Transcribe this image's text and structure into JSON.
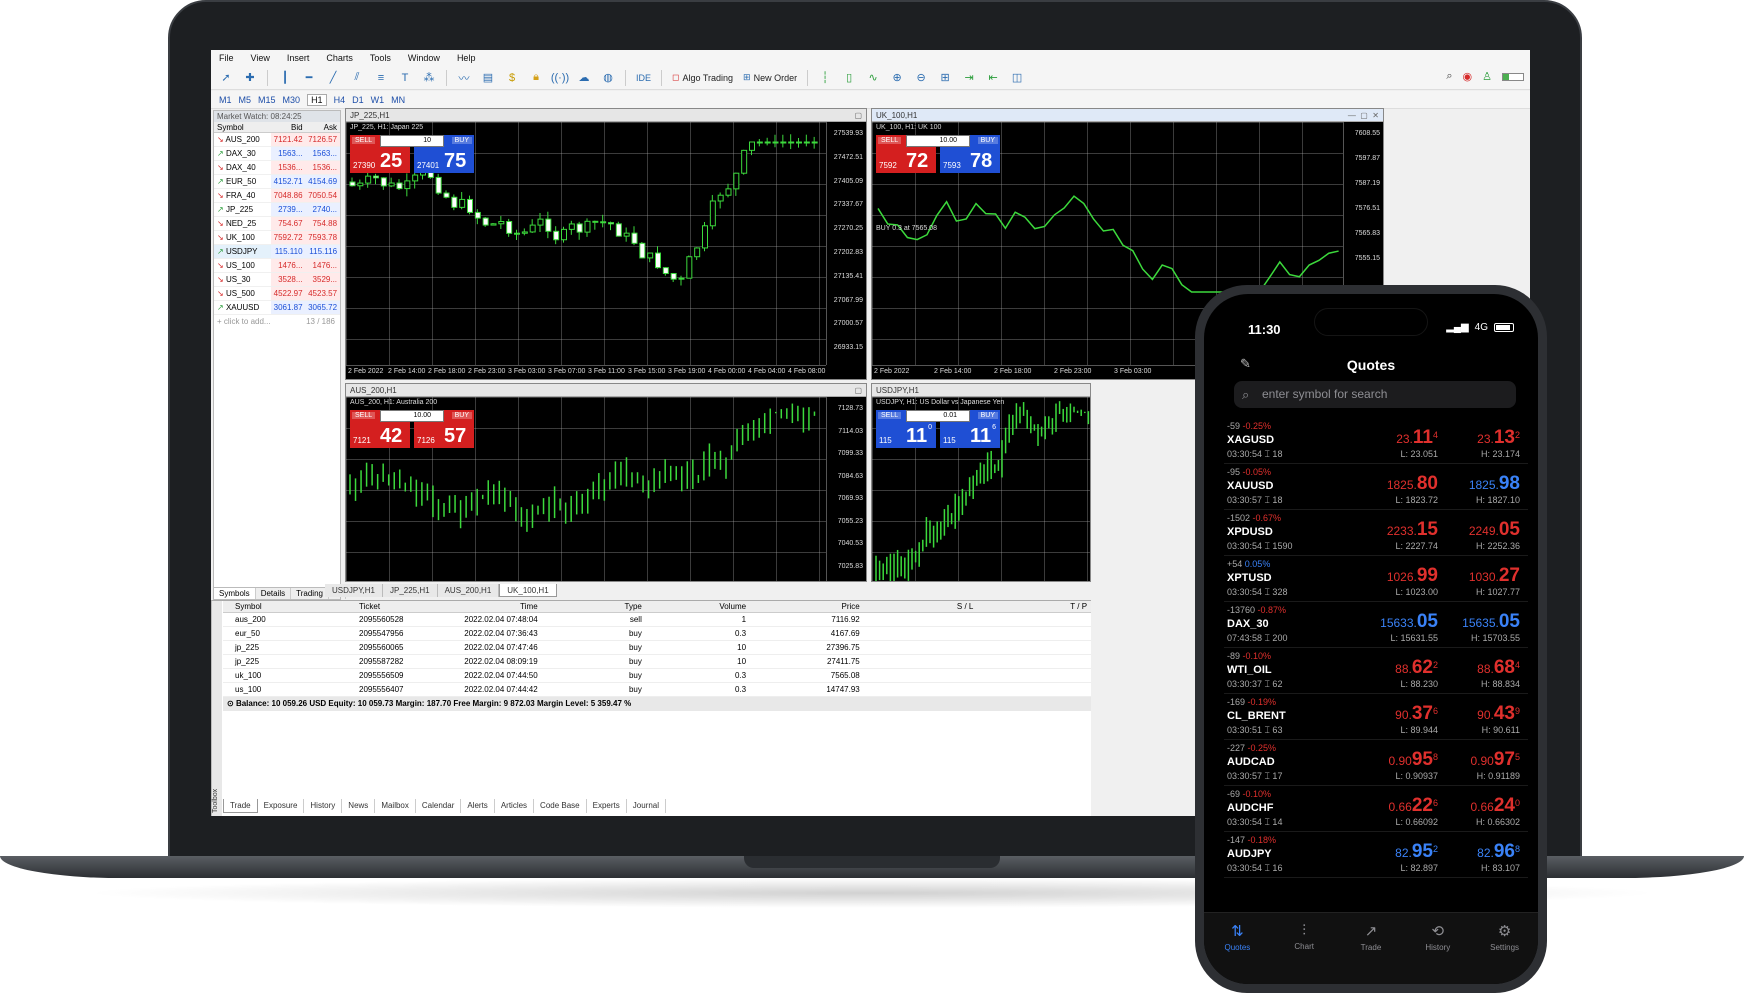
{
  "menu": [
    "File",
    "View",
    "Insert",
    "Charts",
    "Tools",
    "Window",
    "Help"
  ],
  "toolbar": {
    "ide": "IDE",
    "algo": "Algo Trading",
    "new_order": "New Order"
  },
  "timeframes": [
    "M1",
    "M5",
    "M15",
    "M30",
    "H1",
    "H4",
    "D1",
    "W1",
    "MN"
  ],
  "market_watch": {
    "title": "Market Watch: 08:24:25",
    "headers": {
      "symbol": "Symbol",
      "bid": "Bid",
      "ask": "Ask"
    },
    "rows": [
      {
        "symbol": "AUS_200",
        "bid": "7121.42",
        "ask": "7126.57",
        "dir": "dn"
      },
      {
        "symbol": "DAX_30",
        "bid": "1563...",
        "ask": "1563...",
        "dir": "up"
      },
      {
        "symbol": "DAX_40",
        "bid": "1536...",
        "ask": "1536...",
        "dir": "dn"
      },
      {
        "symbol": "EUR_50",
        "bid": "4152.71",
        "ask": "4154.69",
        "dir": "up"
      },
      {
        "symbol": "FRA_40",
        "bid": "7048.86",
        "ask": "7050.54",
        "dir": "dn"
      },
      {
        "symbol": "JP_225",
        "bid": "2739...",
        "ask": "2740...",
        "dir": "up"
      },
      {
        "symbol": "NED_25",
        "bid": "754.67",
        "ask": "754.88",
        "dir": "dn"
      },
      {
        "symbol": "UK_100",
        "bid": "7592.72",
        "ask": "7593.78",
        "dir": "dn"
      },
      {
        "symbol": "USDJPY",
        "bid": "115.110",
        "ask": "115.116",
        "dir": "up",
        "selected": true
      },
      {
        "symbol": "US_100",
        "bid": "1476...",
        "ask": "1476...",
        "dir": "dn"
      },
      {
        "symbol": "US_30",
        "bid": "3528...",
        "ask": "3529...",
        "dir": "dn"
      },
      {
        "symbol": "US_500",
        "bid": "4522.97",
        "ask": "4523.57",
        "dir": "dn"
      },
      {
        "symbol": "XAUUSD",
        "bid": "3061.87",
        "ask": "3065.72",
        "dir": "up"
      }
    ],
    "add_text": "click to add...",
    "count": "13 / 186",
    "tabs": [
      "Symbols",
      "Details",
      "Trading",
      "Ti"
    ]
  },
  "charts": [
    {
      "title": "JP_225,H1",
      "sub": "JP_225, H1: Japan 225",
      "lot": "10",
      "sell_small": "27390",
      "sell_big": "25",
      "buy_small": "27401",
      "buy_big": "75",
      "prices": [
        "27539.93",
        "27472.51",
        "27405.09",
        "27337.67",
        "27270.25",
        "27202.83",
        "27135.41",
        "27067.99",
        "27000.57",
        "26933.15"
      ],
      "times": [
        "2 Feb 2022",
        "2 Feb 14:00",
        "2 Feb 18:00",
        "2 Feb 23:00",
        "3 Feb 03:00",
        "3 Feb 07:00",
        "3 Feb 11:00",
        "3 Feb 15:00",
        "3 Feb 19:00",
        "4 Feb 00:00",
        "4 Feb 04:00",
        "4 Feb 08:00"
      ]
    },
    {
      "title": "UK_100,H1",
      "sub": "UK_100, H1: UK 100",
      "lot": "10.00",
      "sell_small": "7592",
      "sell_big": "72",
      "buy_small": "7593",
      "buy_big": "78",
      "order_label": "BUY 0.3 at 7565.08",
      "prices": [
        "7608.55",
        "7597.87",
        "7587.19",
        "7576.51",
        "7565.83",
        "7555.15"
      ],
      "times": [
        "2 Feb 2022",
        "2 Feb 14:00",
        "2 Feb 18:00",
        "2 Feb 23:00",
        "3 Feb 03:00"
      ]
    },
    {
      "title": "AUS_200,H1",
      "sub": "AUS_200, H1: Australia 200",
      "lot": "10.00",
      "sell_small": "7121",
      "sell_big": "42",
      "buy_small": "7126",
      "buy_big": "57",
      "prices": [
        "7128.73",
        "7114.03",
        "7099.33",
        "7084.63",
        "7069.93",
        "7055.23",
        "7040.53",
        "7025.83"
      ]
    },
    {
      "title": "USDJPY,H1",
      "sub": "USDJPY, H1: US Dollar vs Japanese Yen",
      "lot": "0.01",
      "sell_small": "115",
      "sell_big": "11",
      "sell_sup": "0",
      "buy_small": "115",
      "buy_big": "11",
      "buy_sup": "6"
    }
  ],
  "chart_tabs": [
    "USDJPY,H1",
    "JP_225,H1",
    "AUS_200,H1",
    "UK_100,H1"
  ],
  "trade": {
    "headers": [
      "Symbol",
      "Ticket",
      "Time",
      "Type",
      "Volume",
      "Price",
      "S / L",
      "T / P"
    ],
    "rows": [
      [
        "aus_200",
        "2095560528",
        "2022.02.04 07:48:04",
        "sell",
        "1",
        "7116.92"
      ],
      [
        "eur_50",
        "2095547956",
        "2022.02.04 07:36:43",
        "buy",
        "0.3",
        "4167.69"
      ],
      [
        "jp_225",
        "2095560065",
        "2022.02.04 07:47:46",
        "buy",
        "10",
        "27396.75"
      ],
      [
        "jp_225",
        "2095587282",
        "2022.02.04 08:09:19",
        "buy",
        "10",
        "27411.75"
      ],
      [
        "uk_100",
        "2095556509",
        "2022.02.04 07:44:50",
        "buy",
        "0.3",
        "7565.08"
      ],
      [
        "us_100",
        "2095556407",
        "2022.02.04 07:44:42",
        "buy",
        "0.3",
        "14747.93"
      ]
    ],
    "balance": "Balance: 10 059.26 USD  Equity: 10 059.73  Margin: 187.70  Free Margin: 9 872.03  Margin Level: 5 359.47 %",
    "tabs": [
      "Trade",
      "Exposure",
      "History",
      "News",
      "Mailbox",
      "Calendar",
      "Alerts",
      "Articles",
      "Code Base",
      "Experts",
      "Journal"
    ],
    "toolbox": "Toolbox"
  },
  "phone": {
    "time": "11:30",
    "network": "4G",
    "title": "Quotes",
    "search_placeholder": "enter symbol for search",
    "quotes": [
      {
        "pts": "-59",
        "pct": "-0.25%",
        "sym": "XAGUSD",
        "meta": "03:30:54 ⌶ 18",
        "bid_pre": "23.",
        "bid_big": "11",
        "bid_sup": "4",
        "ask_pre": "23.",
        "ask_big": "13",
        "ask_sup": "2",
        "low": "L: 23.051",
        "high": "H: 23.174",
        "bid_color": "red",
        "ask_color": "red",
        "neg": true
      },
      {
        "pts": "-95",
        "pct": "-0.05%",
        "sym": "XAUUSD",
        "meta": "03:30:57 ⌶ 18",
        "bid_pre": "1825.",
        "bid_big": "80",
        "bid_sup": "",
        "ask_pre": "1825.",
        "ask_big": "98",
        "ask_sup": "",
        "low": "L: 1823.72",
        "high": "H: 1827.10",
        "bid_color": "red",
        "ask_color": "blue",
        "neg": true
      },
      {
        "pts": "-1502",
        "pct": "-0.67%",
        "sym": "XPDUSD",
        "meta": "03:30:54 ⌶ 1590",
        "bid_pre": "2233.",
        "bid_big": "15",
        "bid_sup": "",
        "ask_pre": "2249.",
        "ask_big": "05",
        "ask_sup": "",
        "low": "L: 2227.74",
        "high": "H: 2252.36",
        "bid_color": "red",
        "ask_color": "red",
        "neg": true
      },
      {
        "pts": "+54",
        "pct": "0.05%",
        "sym": "XPTUSD",
        "meta": "03:30:54 ⌶ 328",
        "bid_pre": "1026.",
        "bid_big": "99",
        "bid_sup": "",
        "ask_pre": "1030.",
        "ask_big": "27",
        "ask_sup": "",
        "low": "L: 1023.00",
        "high": "H: 1027.77",
        "bid_color": "red",
        "ask_color": "red",
        "neg": false
      },
      {
        "pts": "-13760",
        "pct": "-0.87%",
        "sym": "DAX_30",
        "meta": "07:43:58 ⌶ 200",
        "bid_pre": "15633.",
        "bid_big": "05",
        "bid_sup": "",
        "ask_pre": "15635.",
        "ask_big": "05",
        "ask_sup": "",
        "low": "L: 15631.55",
        "high": "H: 15703.55",
        "bid_color": "blue",
        "ask_color": "blue",
        "neg": true
      },
      {
        "pts": "-89",
        "pct": "-0.10%",
        "sym": "WTI_OIL",
        "meta": "03:30:37 ⌶ 62",
        "bid_pre": "88.",
        "bid_big": "62",
        "bid_sup": "2",
        "ask_pre": "88.",
        "ask_big": "68",
        "ask_sup": "4",
        "low": "L: 88.230",
        "high": "H: 88.834",
        "bid_color": "red",
        "ask_color": "red",
        "neg": true
      },
      {
        "pts": "-169",
        "pct": "-0.19%",
        "sym": "CL_BRENT",
        "meta": "03:30:51 ⌶ 63",
        "bid_pre": "90.",
        "bid_big": "37",
        "bid_sup": "6",
        "ask_pre": "90.",
        "ask_big": "43",
        "ask_sup": "9",
        "low": "L: 89.944",
        "high": "H: 90.611",
        "bid_color": "red",
        "ask_color": "red",
        "neg": true
      },
      {
        "pts": "-227",
        "pct": "-0.25%",
        "sym": "AUDCAD",
        "meta": "03:30:57 ⌶ 17",
        "bid_pre": "0.90",
        "bid_big": "95",
        "bid_sup": "8",
        "ask_pre": "0.90",
        "ask_big": "97",
        "ask_sup": "5",
        "low": "L: 0.90937",
        "high": "H: 0.91189",
        "bid_color": "red",
        "ask_color": "red",
        "neg": true
      },
      {
        "pts": "-69",
        "pct": "-0.10%",
        "sym": "AUDCHF",
        "meta": "03:30:54 ⌶ 14",
        "bid_pre": "0.66",
        "bid_big": "22",
        "bid_sup": "6",
        "ask_pre": "0.66",
        "ask_big": "24",
        "ask_sup": "0",
        "low": "L: 0.66092",
        "high": "H: 0.66302",
        "bid_color": "red",
        "ask_color": "red",
        "neg": true
      },
      {
        "pts": "-147",
        "pct": "-0.18%",
        "sym": "AUDJPY",
        "meta": "03:30:54 ⌶ 16",
        "bid_pre": "82.",
        "bid_big": "95",
        "bid_sup": "2",
        "ask_pre": "82.",
        "ask_big": "96",
        "ask_sup": "8",
        "low": "L: 82.897",
        "high": "H: 83.107",
        "bid_color": "blue",
        "ask_color": "blue",
        "neg": true
      }
    ],
    "tabs": [
      {
        "label": "Quotes",
        "icon": "⇅",
        "active": true
      },
      {
        "label": "Chart",
        "icon": "⫶",
        "active": false
      },
      {
        "label": "Trade",
        "icon": "↗",
        "active": false
      },
      {
        "label": "History",
        "icon": "⟲",
        "active": false
      },
      {
        "label": "Settings",
        "icon": "⚙",
        "active": false
      }
    ]
  }
}
